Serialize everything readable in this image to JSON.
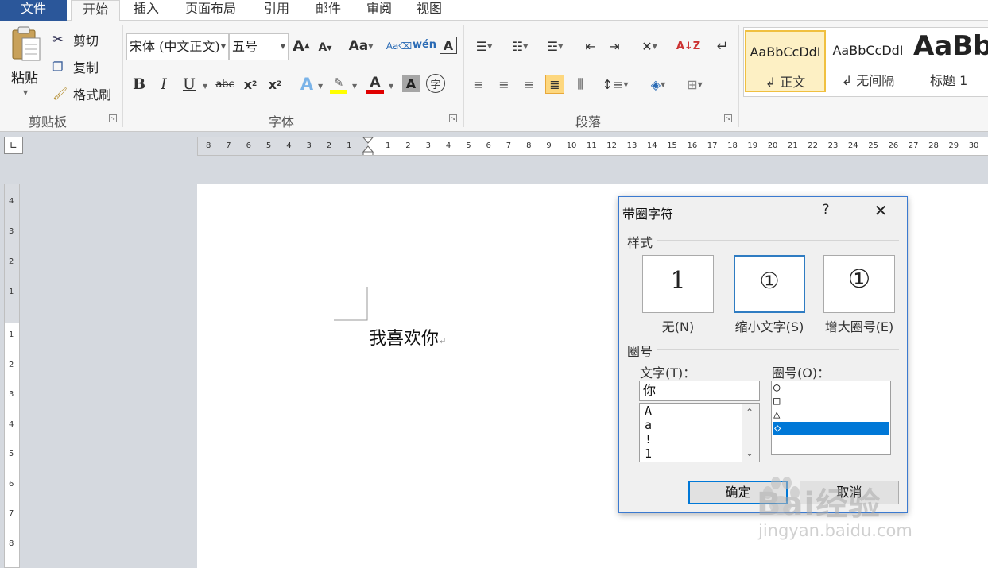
{
  "tabs": [
    {
      "label": "文件"
    },
    {
      "label": "开始"
    },
    {
      "label": "插入"
    },
    {
      "label": "页面布局"
    },
    {
      "label": "引用"
    },
    {
      "label": "邮件"
    },
    {
      "label": "审阅"
    },
    {
      "label": "视图"
    }
  ],
  "clipboard": {
    "group_label": "剪贴板",
    "paste_label": "粘贴",
    "cut_label": "剪切",
    "copy_label": "复制",
    "format_painter_label": "格式刷"
  },
  "font": {
    "group_label": "字体",
    "font_name": "宋体 (中文正文)",
    "font_size": "五号"
  },
  "paragraph": {
    "group_label": "段落"
  },
  "styles": [
    {
      "sample": "AaBbCcDdI",
      "name": "↲ 正文"
    },
    {
      "sample": "AaBbCcDdI",
      "name": "↲ 无间隔"
    },
    {
      "sample": "AaBb",
      "name": "标题 1"
    }
  ],
  "ruler": {
    "left_numbers": [
      "8",
      "7",
      "6",
      "5",
      "4",
      "3",
      "2",
      "1"
    ],
    "right_numbers": [
      "1",
      "2",
      "3",
      "4",
      "5",
      "6",
      "7",
      "8",
      "9",
      "10",
      "11",
      "12",
      "13",
      "14",
      "15",
      "16",
      "17",
      "18",
      "19",
      "20",
      "21",
      "22",
      "23",
      "24",
      "25",
      "26",
      "27",
      "28",
      "29",
      "30"
    ],
    "vertical_top": [
      "4",
      "3",
      "2",
      "1"
    ],
    "vertical_bottom": [
      "1",
      "2",
      "3",
      "4",
      "5",
      "6",
      "7",
      "8"
    ]
  },
  "document": {
    "text": "我喜欢你",
    "paragraph_mark": "↵"
  },
  "dialog": {
    "title": "带圈字符",
    "help": "?",
    "close": "✕",
    "style_section": "样式",
    "style_options": [
      {
        "glyph": "1",
        "label": "无(N)"
      },
      {
        "glyph": "①",
        "label": "缩小文字(S)"
      },
      {
        "glyph": "①",
        "label": "增大圈号(E)"
      }
    ],
    "enclosure_section": "圈号",
    "text_label": "文字(T)：",
    "text_value": "你",
    "text_list": [
      "A",
      "a",
      "!",
      "1"
    ],
    "enclosure_label": "圈号(O)：",
    "enclosure_list": [
      "○",
      "□",
      "△",
      "◇"
    ],
    "ok": "确定",
    "cancel": "取消"
  },
  "watermark": {
    "brand": "Bai经验",
    "url": "jingyan.baidu.com"
  }
}
